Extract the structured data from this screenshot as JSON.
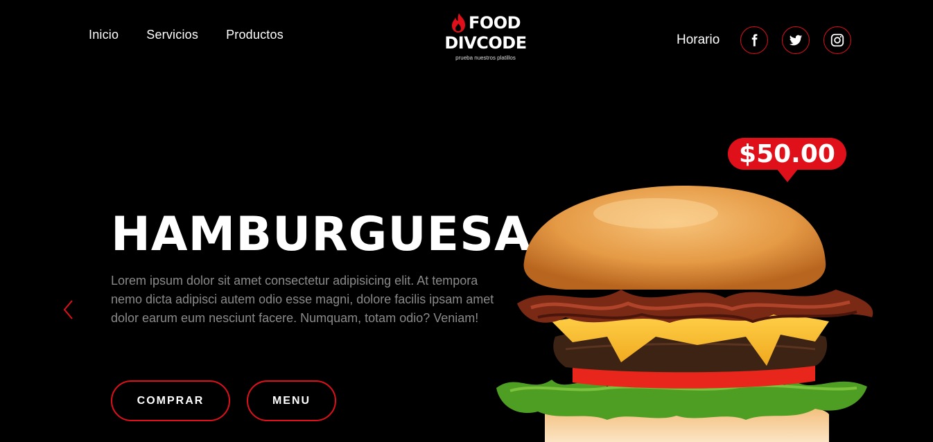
{
  "nav": {
    "items": [
      {
        "label": "Inicio"
      },
      {
        "label": "Servicios"
      },
      {
        "label": "Productos"
      }
    ]
  },
  "logo": {
    "line1": "FOOD",
    "line2": "DIVCODE",
    "tagline": "prueba nuestros platillos",
    "icon": "flame-icon"
  },
  "header_right": {
    "horario_label": "Horario",
    "social": [
      {
        "icon": "facebook-icon"
      },
      {
        "icon": "twitter-icon"
      },
      {
        "icon": "instagram-icon"
      }
    ]
  },
  "hero": {
    "title": "HAMBURGUESA",
    "description": "Lorem ipsum dolor sit amet consectetur adipisicing elit. At tempora nemo dicta adipisci autem odio esse magni, dolore facilis ipsam amet dolor earum eum nesciunt facere. Numquam, totam odio? Veniam!",
    "buy_label": "COMPRAR",
    "menu_label": "MENU",
    "price": "$50.00",
    "prev_icon": "chevron-left-icon"
  },
  "colors": {
    "accent": "#e0101a",
    "background": "#000000",
    "text": "#ffffff",
    "muted": "#8a8a8a"
  }
}
